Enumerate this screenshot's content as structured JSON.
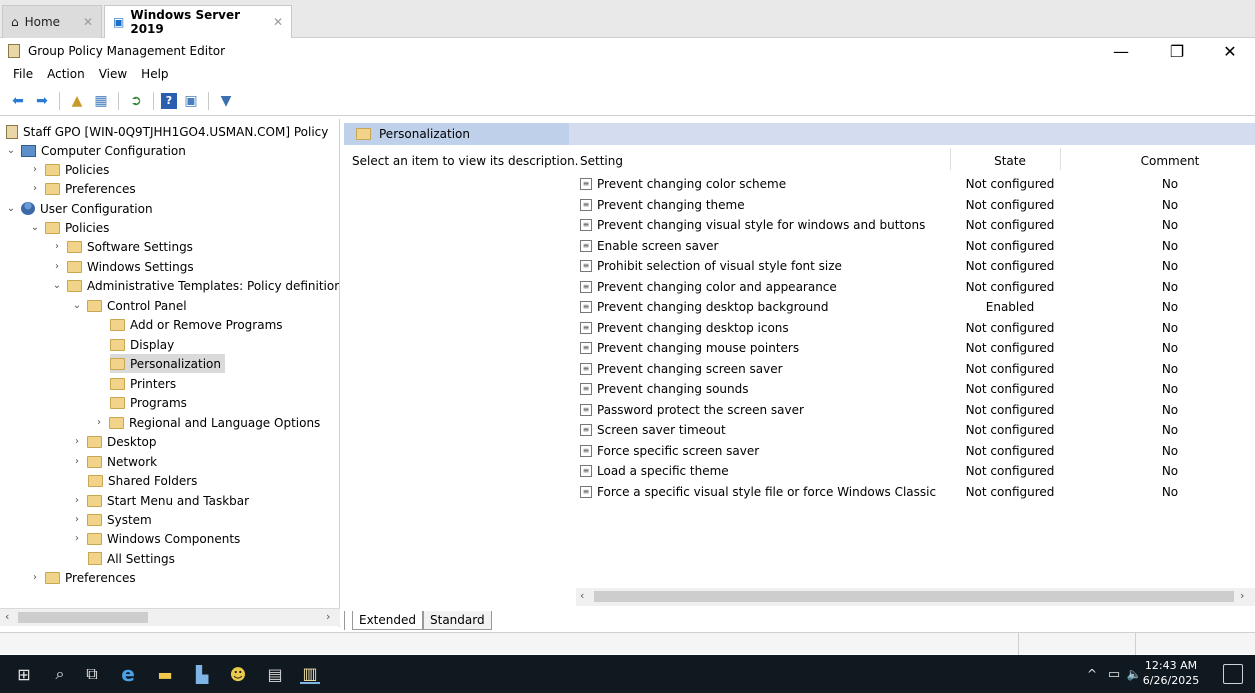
{
  "vm_tabs": [
    {
      "label": "Home"
    },
    {
      "label": "Windows Server 2019"
    }
  ],
  "app": {
    "title": "Group Policy Management Editor"
  },
  "menu": [
    "File",
    "Action",
    "View",
    "Help"
  ],
  "tree": {
    "root": "Staff GPO [WIN-0Q9TJHH1GO4.USMAN.COM] Policy",
    "computer_config": "Computer Configuration",
    "cc_policies": "Policies",
    "cc_preferences": "Preferences",
    "user_config": "User Configuration",
    "uc_policies": "Policies",
    "software_settings": "Software Settings",
    "windows_settings": "Windows Settings",
    "admin_templates": "Administrative Templates: Policy definition",
    "control_panel": "Control Panel",
    "add_remove": "Add or Remove Programs",
    "display": "Display",
    "personalization": "Personalization",
    "printers": "Printers",
    "programs": "Programs",
    "regional": "Regional and Language Options",
    "desktop": "Desktop",
    "network": "Network",
    "shared_folders": "Shared Folders",
    "start_menu": "Start Menu and Taskbar",
    "system": "System",
    "windows_components": "Windows Components",
    "all_settings": "All Settings",
    "uc_preferences": "Preferences"
  },
  "panel": {
    "header": "Personalization",
    "description": "Select an item to view its description.",
    "columns": {
      "setting": "Setting",
      "state": "State",
      "comment": "Comment"
    },
    "rows": [
      {
        "setting": "Prevent changing color scheme",
        "state": "Not configured",
        "comment": "No"
      },
      {
        "setting": "Prevent changing theme",
        "state": "Not configured",
        "comment": "No"
      },
      {
        "setting": "Prevent changing visual style for windows and buttons",
        "state": "Not configured",
        "comment": "No"
      },
      {
        "setting": "Enable screen saver",
        "state": "Not configured",
        "comment": "No"
      },
      {
        "setting": "Prohibit selection of visual style font size",
        "state": "Not configured",
        "comment": "No"
      },
      {
        "setting": "Prevent changing color and appearance",
        "state": "Not configured",
        "comment": "No"
      },
      {
        "setting": "Prevent changing desktop background",
        "state": "Enabled",
        "comment": "No"
      },
      {
        "setting": "Prevent changing desktop icons",
        "state": "Not configured",
        "comment": "No"
      },
      {
        "setting": "Prevent changing mouse pointers",
        "state": "Not configured",
        "comment": "No"
      },
      {
        "setting": "Prevent changing screen saver",
        "state": "Not configured",
        "comment": "No"
      },
      {
        "setting": "Prevent changing sounds",
        "state": "Not configured",
        "comment": "No"
      },
      {
        "setting": "Password protect the screen saver",
        "state": "Not configured",
        "comment": "No"
      },
      {
        "setting": "Screen saver timeout",
        "state": "Not configured",
        "comment": "No"
      },
      {
        "setting": "Force specific screen saver",
        "state": "Not configured",
        "comment": "No"
      },
      {
        "setting": "Load a specific theme",
        "state": "Not configured",
        "comment": "No"
      },
      {
        "setting": "Force a specific visual style file or force Windows Classic",
        "state": "Not configured",
        "comment": "No"
      }
    ]
  },
  "bottom_tabs": [
    "Extended",
    "Standard"
  ],
  "clock": {
    "time": "12:43 AM",
    "date": "6/26/2025"
  }
}
